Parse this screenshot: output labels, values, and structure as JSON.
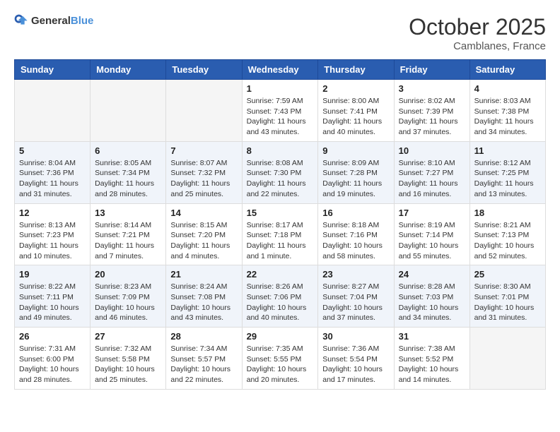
{
  "header": {
    "logo_line1": "General",
    "logo_line2": "Blue",
    "month": "October 2025",
    "location": "Camblanes, France"
  },
  "days_of_week": [
    "Sunday",
    "Monday",
    "Tuesday",
    "Wednesday",
    "Thursday",
    "Friday",
    "Saturday"
  ],
  "weeks": [
    {
      "days": [
        {
          "number": "",
          "empty": true
        },
        {
          "number": "",
          "empty": true
        },
        {
          "number": "",
          "empty": true
        },
        {
          "number": "1",
          "sunrise": "7:59 AM",
          "sunset": "7:43 PM",
          "daylight": "11 hours and 43 minutes."
        },
        {
          "number": "2",
          "sunrise": "8:00 AM",
          "sunset": "7:41 PM",
          "daylight": "11 hours and 40 minutes."
        },
        {
          "number": "3",
          "sunrise": "8:02 AM",
          "sunset": "7:39 PM",
          "daylight": "11 hours and 37 minutes."
        },
        {
          "number": "4",
          "sunrise": "8:03 AM",
          "sunset": "7:38 PM",
          "daylight": "11 hours and 34 minutes."
        }
      ]
    },
    {
      "days": [
        {
          "number": "5",
          "sunrise": "8:04 AM",
          "sunset": "7:36 PM",
          "daylight": "11 hours and 31 minutes."
        },
        {
          "number": "6",
          "sunrise": "8:05 AM",
          "sunset": "7:34 PM",
          "daylight": "11 hours and 28 minutes."
        },
        {
          "number": "7",
          "sunrise": "8:07 AM",
          "sunset": "7:32 PM",
          "daylight": "11 hours and 25 minutes."
        },
        {
          "number": "8",
          "sunrise": "8:08 AM",
          "sunset": "7:30 PM",
          "daylight": "11 hours and 22 minutes."
        },
        {
          "number": "9",
          "sunrise": "8:09 AM",
          "sunset": "7:28 PM",
          "daylight": "11 hours and 19 minutes."
        },
        {
          "number": "10",
          "sunrise": "8:10 AM",
          "sunset": "7:27 PM",
          "daylight": "11 hours and 16 minutes."
        },
        {
          "number": "11",
          "sunrise": "8:12 AM",
          "sunset": "7:25 PM",
          "daylight": "11 hours and 13 minutes."
        }
      ]
    },
    {
      "days": [
        {
          "number": "12",
          "sunrise": "8:13 AM",
          "sunset": "7:23 PM",
          "daylight": "11 hours and 10 minutes."
        },
        {
          "number": "13",
          "sunrise": "8:14 AM",
          "sunset": "7:21 PM",
          "daylight": "11 hours and 7 minutes."
        },
        {
          "number": "14",
          "sunrise": "8:15 AM",
          "sunset": "7:20 PM",
          "daylight": "11 hours and 4 minutes."
        },
        {
          "number": "15",
          "sunrise": "8:17 AM",
          "sunset": "7:18 PM",
          "daylight": "11 hours and 1 minute."
        },
        {
          "number": "16",
          "sunrise": "8:18 AM",
          "sunset": "7:16 PM",
          "daylight": "10 hours and 58 minutes."
        },
        {
          "number": "17",
          "sunrise": "8:19 AM",
          "sunset": "7:14 PM",
          "daylight": "10 hours and 55 minutes."
        },
        {
          "number": "18",
          "sunrise": "8:21 AM",
          "sunset": "7:13 PM",
          "daylight": "10 hours and 52 minutes."
        }
      ]
    },
    {
      "days": [
        {
          "number": "19",
          "sunrise": "8:22 AM",
          "sunset": "7:11 PM",
          "daylight": "10 hours and 49 minutes."
        },
        {
          "number": "20",
          "sunrise": "8:23 AM",
          "sunset": "7:09 PM",
          "daylight": "10 hours and 46 minutes."
        },
        {
          "number": "21",
          "sunrise": "8:24 AM",
          "sunset": "7:08 PM",
          "daylight": "10 hours and 43 minutes."
        },
        {
          "number": "22",
          "sunrise": "8:26 AM",
          "sunset": "7:06 PM",
          "daylight": "10 hours and 40 minutes."
        },
        {
          "number": "23",
          "sunrise": "8:27 AM",
          "sunset": "7:04 PM",
          "daylight": "10 hours and 37 minutes."
        },
        {
          "number": "24",
          "sunrise": "8:28 AM",
          "sunset": "7:03 PM",
          "daylight": "10 hours and 34 minutes."
        },
        {
          "number": "25",
          "sunrise": "8:30 AM",
          "sunset": "7:01 PM",
          "daylight": "10 hours and 31 minutes."
        }
      ]
    },
    {
      "days": [
        {
          "number": "26",
          "sunrise": "7:31 AM",
          "sunset": "6:00 PM",
          "daylight": "10 hours and 28 minutes."
        },
        {
          "number": "27",
          "sunrise": "7:32 AM",
          "sunset": "5:58 PM",
          "daylight": "10 hours and 25 minutes."
        },
        {
          "number": "28",
          "sunrise": "7:34 AM",
          "sunset": "5:57 PM",
          "daylight": "10 hours and 22 minutes."
        },
        {
          "number": "29",
          "sunrise": "7:35 AM",
          "sunset": "5:55 PM",
          "daylight": "10 hours and 20 minutes."
        },
        {
          "number": "30",
          "sunrise": "7:36 AM",
          "sunset": "5:54 PM",
          "daylight": "10 hours and 17 minutes."
        },
        {
          "number": "31",
          "sunrise": "7:38 AM",
          "sunset": "5:52 PM",
          "daylight": "10 hours and 14 minutes."
        },
        {
          "number": "",
          "empty": true
        }
      ]
    }
  ]
}
